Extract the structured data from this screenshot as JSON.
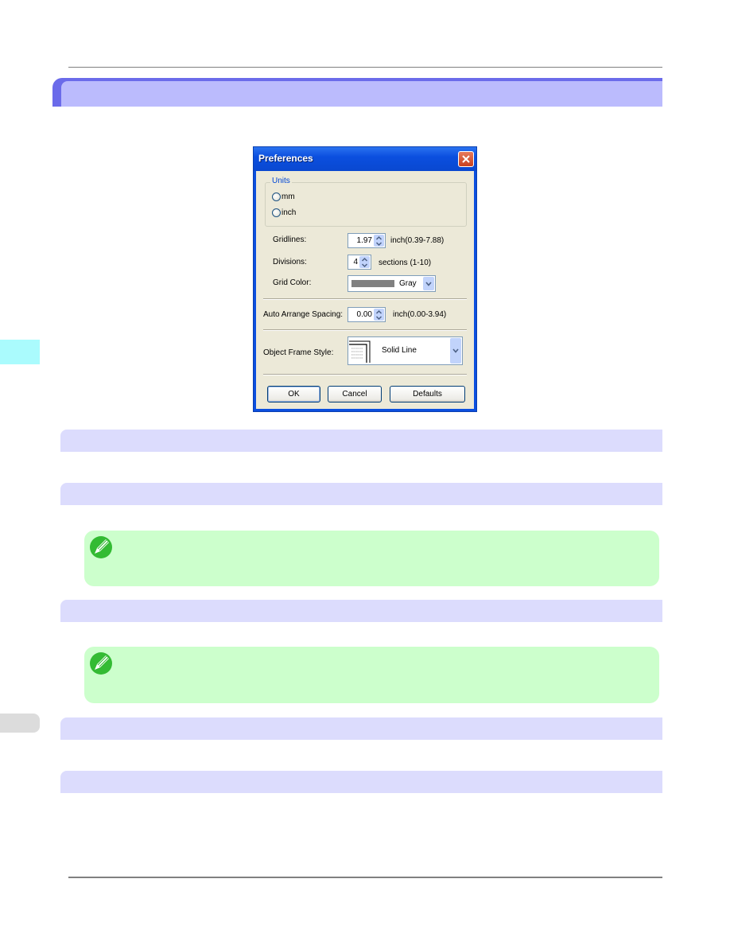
{
  "dialog": {
    "title": "Preferences",
    "units": {
      "legend": "Units",
      "options": [
        {
          "label": "mm",
          "selected": false
        },
        {
          "label": "inch",
          "selected": false
        }
      ]
    },
    "gridlines": {
      "label": "Gridlines:",
      "value": "1.97",
      "range": "inch(0.39-7.88)"
    },
    "divisions": {
      "label": "Divisions:",
      "value": "4",
      "range": "sections (1-10)"
    },
    "grid_color": {
      "label": "Grid Color:",
      "value": "Gray",
      "swatch": "#808080"
    },
    "auto_arrange": {
      "label": "Auto Arrange Spacing:",
      "value": "0.00",
      "range": "inch(0.00-3.94)"
    },
    "frame_style": {
      "label": "Object Frame Style:",
      "value": "Solid Line"
    },
    "buttons": {
      "ok": "OK",
      "cancel": "Cancel",
      "defaults": "Defaults"
    }
  },
  "colors": {
    "chapter_bar": "#bbbbfd",
    "chapter_bar_edge": "#6b6bea",
    "section_bar": "#dcdcfd",
    "note_box": "#ccffcc",
    "note_icon": "#33bb33",
    "side_tab_cyan": "#aafbfd",
    "side_tab_gray": "#dcdcdc"
  },
  "page": {
    "notes": [
      {
        "icon": "pencil-note-icon"
      },
      {
        "icon": "pencil-note-icon"
      }
    ]
  }
}
